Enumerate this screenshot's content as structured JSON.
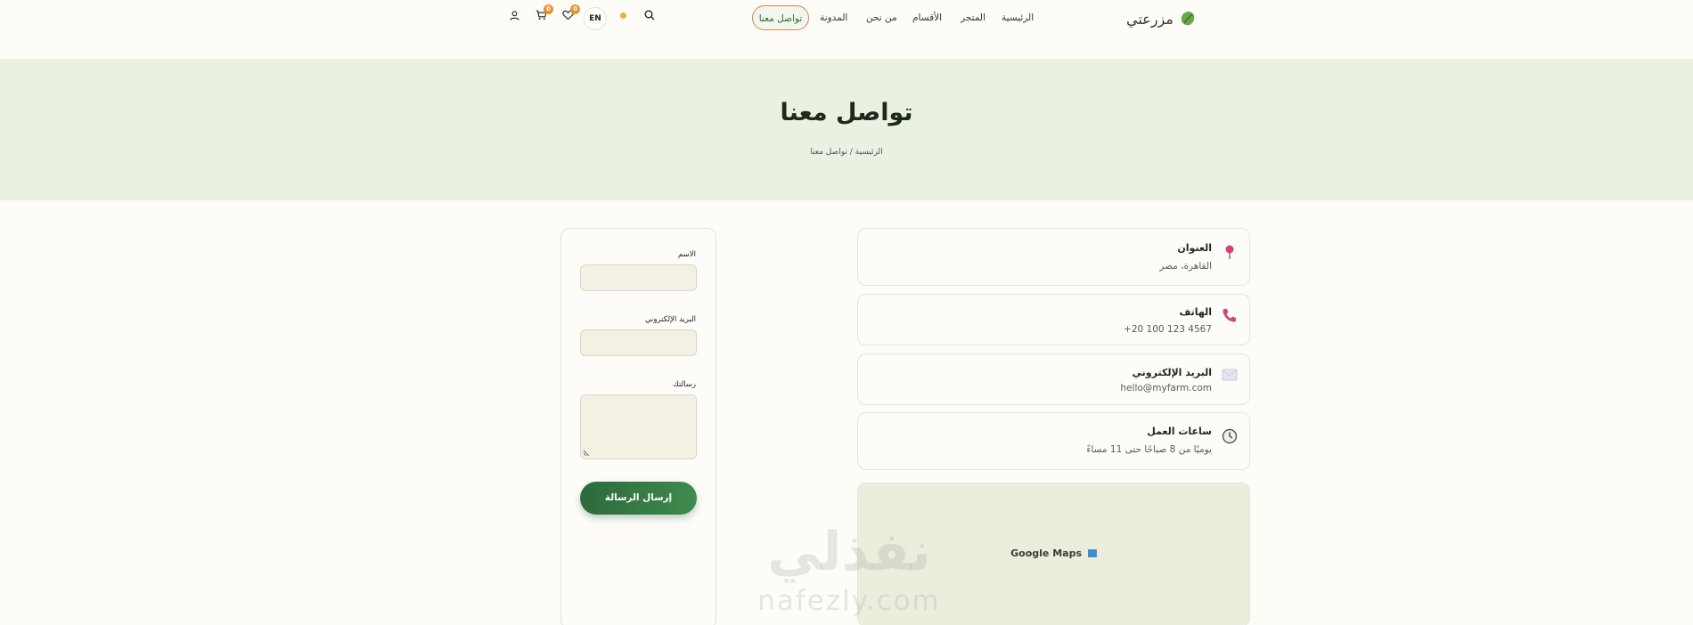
{
  "brand": {
    "name": "مزرعتي",
    "logo_icon": "leaf-icon"
  },
  "nav": {
    "items": [
      {
        "label": "الرئيسية"
      },
      {
        "label": "المتجر"
      },
      {
        "label": "الأقسام"
      },
      {
        "label": "من نحن"
      },
      {
        "label": "المدونة"
      },
      {
        "label": "تواصل معنا",
        "active": true
      }
    ]
  },
  "toolbar": {
    "language": "EN",
    "cart_count": "0",
    "wishlist_count": "0"
  },
  "hero": {
    "title": "تواصل معنا",
    "breadcrumb": "الرئيسية / تواصل معنا"
  },
  "contact": {
    "address": {
      "title": "العنوان",
      "value": "القاهرة، مصر",
      "icon": "pin-icon"
    },
    "phone": {
      "title": "الهاتف",
      "value": "+20 100 123 4567",
      "icon": "phone-icon"
    },
    "email": {
      "title": "البريد الإلكتروني",
      "value": "hello@myfarm.com",
      "icon": "envelope-icon"
    },
    "hours": {
      "title": "ساعات العمل",
      "value": "يوميًا من 8 صباحًا حتى 11 مساءً",
      "icon": "clock-icon"
    }
  },
  "map": {
    "label": "Google Maps"
  },
  "form": {
    "name_label": "الاسم",
    "email_label": "البريد الإلكتروني",
    "message_label": "رسالتك",
    "submit_label": "إرسال الرسالة"
  },
  "watermark": {
    "ar": "نفذلي",
    "en": "nafezly.com"
  },
  "colors": {
    "primary": "#2d6a3c",
    "accent": "#e6922e",
    "hero_bg": "#eaf0e2",
    "page_bg": "#fdfcf7"
  }
}
